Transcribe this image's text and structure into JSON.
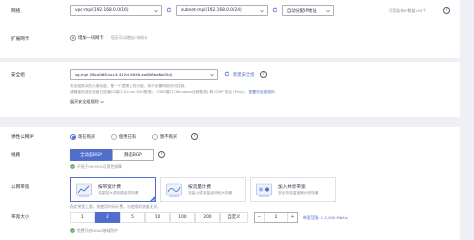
{
  "network": {
    "label": "网络",
    "vpc_value": "vpc-mpi(192.168.0.0/16)",
    "subnet_value": "subnet-mpi(192.168.0.0/24)",
    "ip_mode_value": "自动分配IP地址",
    "available_ip_hint": "可用私有IP数量250个"
  },
  "ext_nic": {
    "label": "扩展网卡",
    "add_label": "增加一块网卡",
    "remaining_hint": "您还可以增加1块网卡"
  },
  "security_group": {
    "label": "安全组",
    "value": "sg-mpi (f6ca068-bcc4-412d-9b56-ea606bd6a05d)",
    "new_link": "新建安全组",
    "hint_line1": "安全组类似防火墙功能，是一个逻辑上的分组，用于设置网络访问控制。",
    "hint_line2": "请确保所选安全组已放通22端口 (Linux SSH登录)，3389端口 (Windows远程登录) 和 ICMP 协议 (Ping)。",
    "hint_link": "配置安全组规则",
    "expand_link": "展开安全组规则"
  },
  "eip": {
    "label": "弹性公网IP",
    "options": [
      "现在购买",
      "使用已有",
      "暂不购买"
    ],
    "selected": 0
  },
  "line": {
    "label": "线路",
    "options": [
      "全动态BGP",
      "静态BGP"
    ],
    "selected": 0,
    "sla_hint": "不低于99.95%可用性保障"
  },
  "bandwidth_type": {
    "label": "公网带宽",
    "cards": [
      {
        "title": "按带宽计费",
        "desc": "流量较大或较稳定的场景"
      },
      {
        "title": "按流量计费",
        "desc": "流量小或流量波动较大场景"
      },
      {
        "title": "加入共享带宽",
        "desc": "多业务流量错峰分布场景"
      }
    ],
    "selected": 0,
    "note": "指定带宽上限，按使用时间计费，与使用的流量无关。"
  },
  "bandwidth_size": {
    "label": "带宽大小",
    "options": [
      "1",
      "2",
      "5",
      "10",
      "100",
      "200",
      "自定义"
    ],
    "selected": 1,
    "value": "2",
    "minus": "−",
    "plus": "+",
    "range_hint": "带宽范围: 1-2,000 Mbit/s",
    "ddos_hint": "免费开启DDoS基础防护"
  },
  "colors": {
    "accent": "#526ecc",
    "ok": "#50a05a"
  }
}
